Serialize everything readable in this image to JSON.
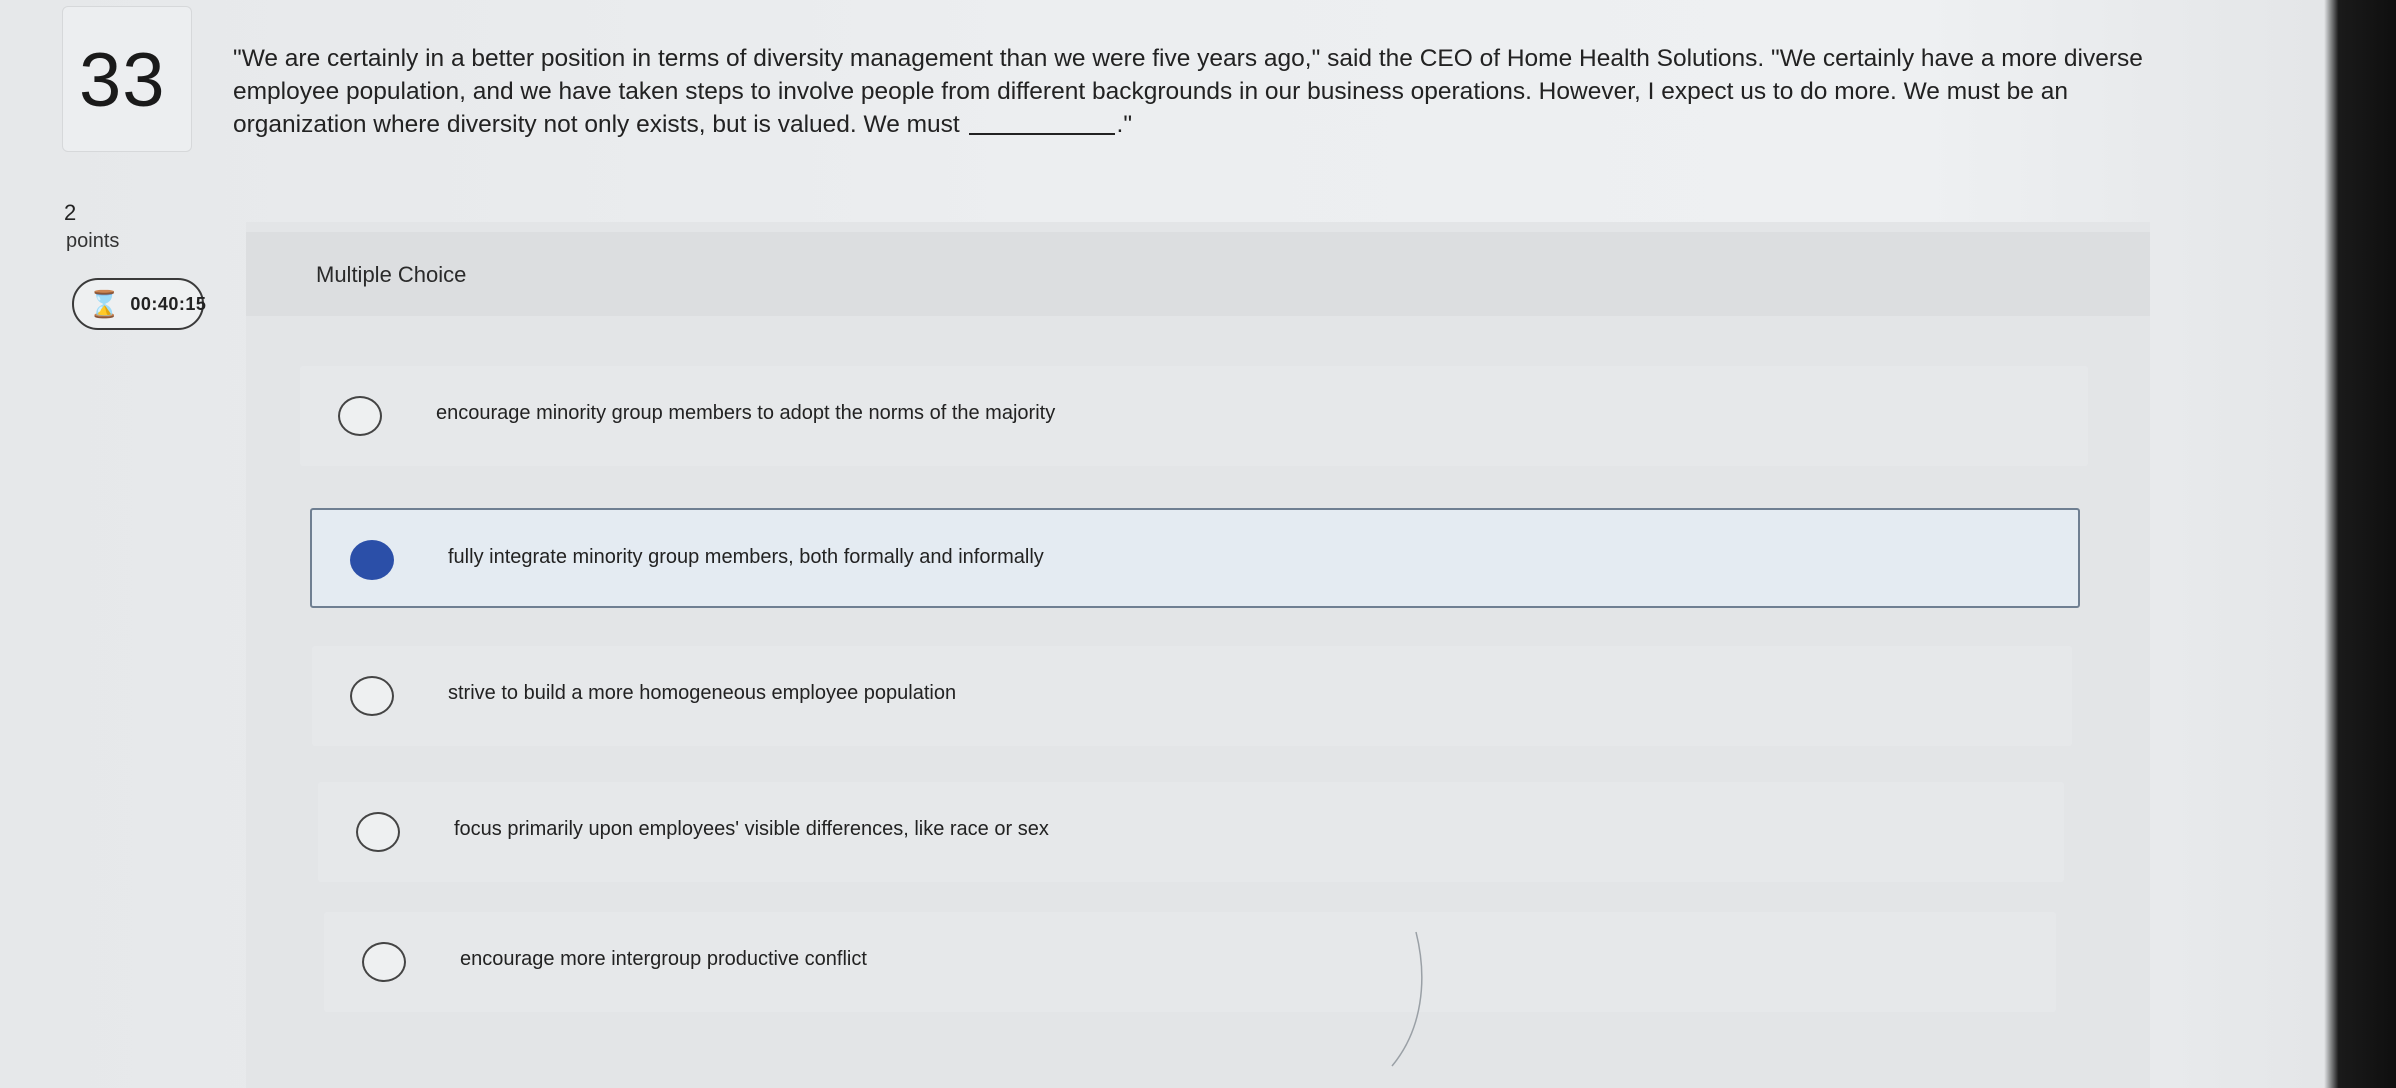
{
  "question": {
    "number": "33",
    "text": "\"We are certainly in a better position in terms of diversity management than we were five years ago,\" said the CEO of Home Health Solutions. \"We certainly have a more diverse employee population, and we have taken steps to involve people from different backgrounds in our business operations. However, I expect us to do more. We must be an organization where diversity not only exists, but is valued. We must",
    "text_end": ".\"",
    "points_value": "2",
    "points_label": "points",
    "timer": "00:40:15"
  },
  "multiple_choice": {
    "title": "Multiple Choice",
    "options": [
      {
        "label": "encourage minority group members to adopt the norms of the majority",
        "selected": false
      },
      {
        "label": "fully integrate minority group members, both formally and informally",
        "selected": true
      },
      {
        "label": "strive to build a more homogeneous employee population",
        "selected": false
      },
      {
        "label": "focus primarily upon employees' visible differences, like race or sex",
        "selected": false
      },
      {
        "label": "encourage more intergroup productive conflict",
        "selected": false
      }
    ]
  },
  "icons": {
    "timer": "hourglass-icon"
  },
  "colors": {
    "selected_radio": "#2b4fa8",
    "selected_border": "#6f7f92"
  }
}
